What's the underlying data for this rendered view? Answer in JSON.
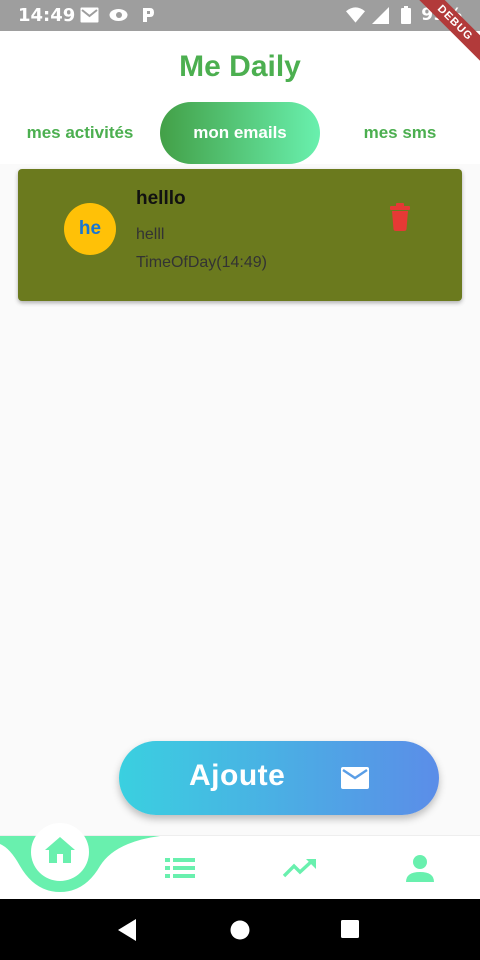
{
  "status_bar": {
    "time": "14:49",
    "battery": "99%",
    "debug_label": "DEBUG"
  },
  "app": {
    "title": "Me Daily",
    "tabs": [
      {
        "label": "mes activités",
        "active": false
      },
      {
        "label": "mon emails",
        "active": true
      },
      {
        "label": "mes sms",
        "active": false
      }
    ]
  },
  "card": {
    "avatar_text": "he",
    "title": "helllo",
    "body": "helll",
    "time": "TimeOfDay(14:49)",
    "background": "#6b7a1e",
    "delete_icon": "trash-icon"
  },
  "fab": {
    "label": "Ajoute",
    "icon": "mail-icon"
  },
  "bottom_nav": {
    "items": [
      "home-icon",
      "list-icon",
      "trending-up-icon",
      "person-icon"
    ],
    "accent": "#69f0ae"
  },
  "colors": {
    "brand_green": "#4caf50",
    "delete_red": "#e53935",
    "avatar_yellow": "#ffc107"
  }
}
